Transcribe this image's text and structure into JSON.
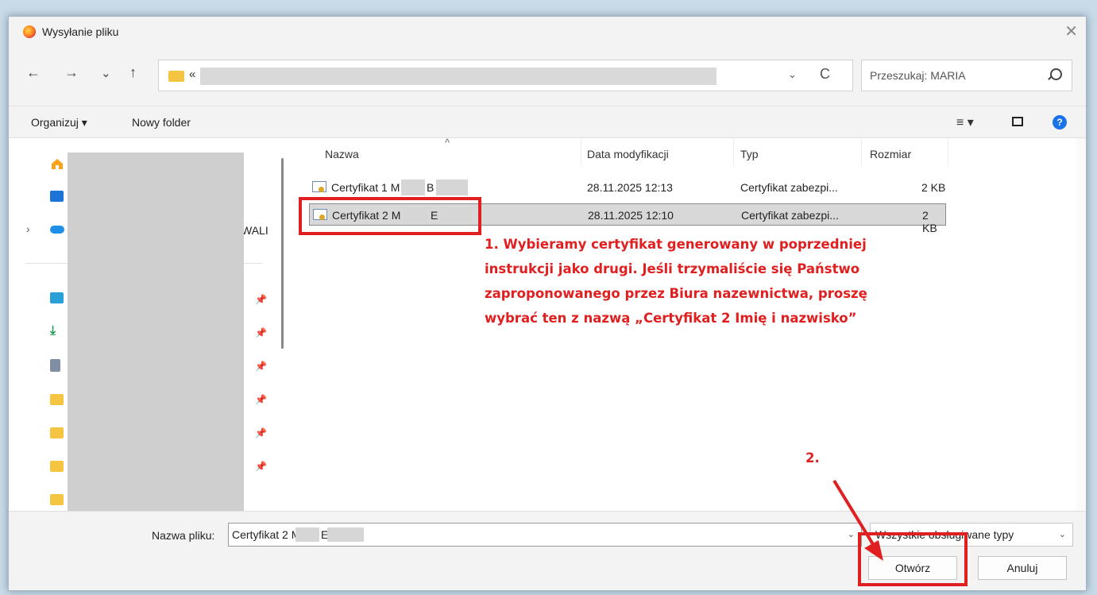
{
  "window": {
    "title": "Wysyłanie pliku",
    "close_glyph": "✕"
  },
  "nav": {
    "back": "←",
    "forward": "→",
    "recent": "⌄",
    "up": "↑",
    "address_prefix": "«",
    "address_chevron": "⌄",
    "refresh": "C"
  },
  "search": {
    "placeholder": "Przeszukaj: MARIA"
  },
  "toolbar": {
    "organize": "Organizuj ▾",
    "new_folder": "Nowy folder",
    "view_menu": "≡ ▾",
    "help": "?"
  },
  "sidebar": {
    "wali_label": "WALI",
    "expand_arrow": "›",
    "pin_glyph": "📌"
  },
  "columns": {
    "name": "Nazwa",
    "date": "Data modyfikacji",
    "type": "Typ",
    "size": "Rozmiar",
    "sort_glyph": "^"
  },
  "files": [
    {
      "name": "Certyfikat 1 M",
      "initial2": "B",
      "date": "28.11.2025 12:13",
      "type": "Certyfikat zabezpi...",
      "size": "2 KB"
    },
    {
      "name": "Certyfikat 2 M",
      "initial2": "E",
      "date": "28.11.2025 12:10",
      "type": "Certyfikat zabezpi...",
      "size": "2 KB"
    }
  ],
  "annotations": {
    "step1_lines": [
      "1. Wybieramy certyfikat generowany w poprzedniej",
      "instrukcji jako drugi. Jeśli trzymaliście się Państwo",
      "zaproponowanego przez Biura nazewnictwa, proszę",
      "wybrać ten z nazwą „Certyfikat 2 Imię i nazwisko”"
    ],
    "step2": "2.",
    "color": "#e02020"
  },
  "footer": {
    "filename_label": "Nazwa pliku:",
    "filename_value": "Certyfikat 2 M",
    "filename_initial2": "E",
    "filetype": "Wszystkie obsługiwane typy",
    "open_button": "Otwórz",
    "cancel_button": "Anuluj"
  }
}
